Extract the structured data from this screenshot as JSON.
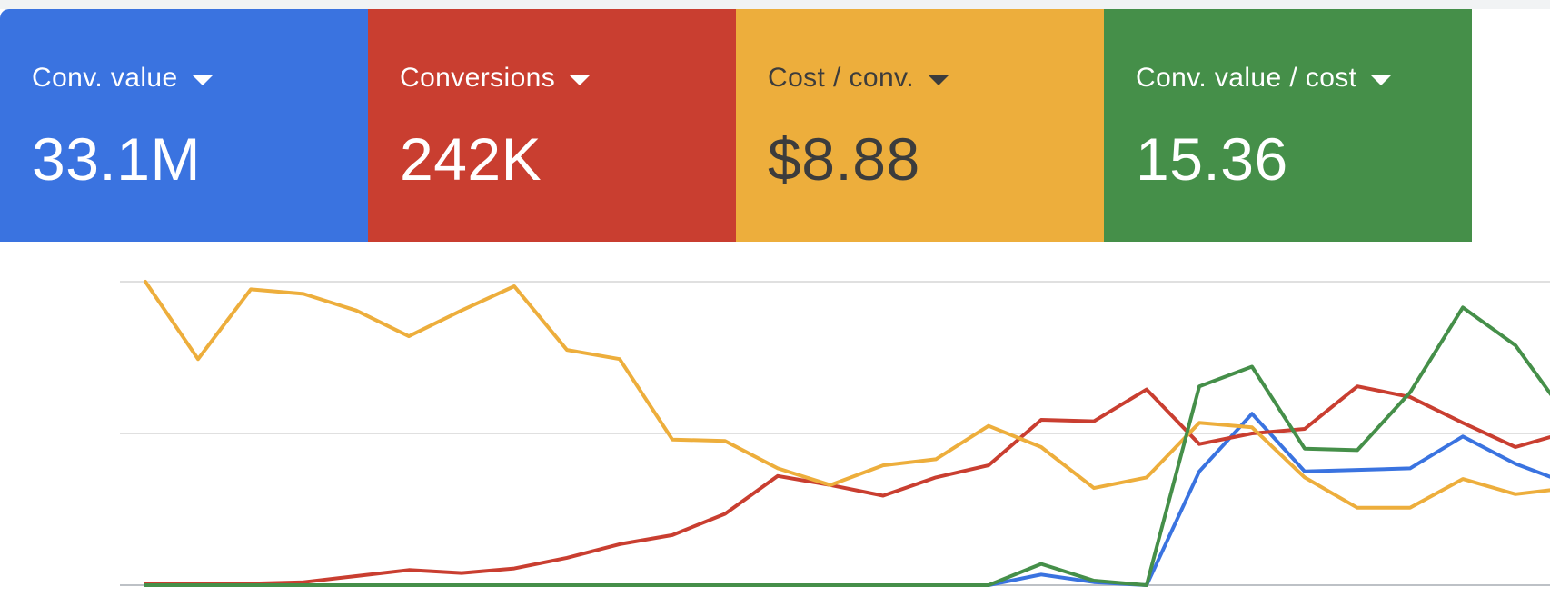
{
  "scorecards": [
    {
      "label": "Conv. value",
      "value": "33.1M",
      "bg": "#3a73e0",
      "fg": "#ffffff",
      "icon": "caret-down-icon"
    },
    {
      "label": "Conversions",
      "value": "242K",
      "bg": "#c93e30",
      "fg": "#ffffff",
      "icon": "caret-down-icon"
    },
    {
      "label": "Cost / conv.",
      "value": "$8.88",
      "bg": "#edae3c",
      "fg": "#3c3c3c",
      "icon": "caret-down-icon"
    },
    {
      "label": "Conv. value / cost",
      "value": "15.36",
      "bg": "#458f49",
      "fg": "#ffffff",
      "icon": "caret-down-icon"
    }
  ],
  "chart_data": {
    "type": "line",
    "x": [
      1,
      2,
      3,
      4,
      5,
      6,
      7,
      8,
      9,
      10,
      11,
      12,
      13,
      14,
      15,
      16,
      17,
      18,
      19,
      20,
      21,
      22,
      23,
      24,
      25,
      26,
      27,
      28,
      29
    ],
    "ylim": [
      0,
      1
    ],
    "grid": true,
    "gridlines": [
      0,
      0.5,
      1
    ],
    "series": [
      {
        "color": "#3a73e0",
        "values": [
          0,
          0,
          0,
          0,
          0,
          0,
          0,
          0,
          0,
          0,
          0,
          0,
          0,
          0,
          0,
          0,
          0,
          0.035,
          0.01,
          0,
          0.375,
          0.565,
          0.375,
          0.38,
          0.385,
          0.49,
          0.4,
          0.335,
          0.28
        ]
      },
      {
        "color": "#c93e30",
        "values": [
          0.005,
          0.005,
          0.005,
          0.01,
          0.03,
          0.05,
          0.04,
          0.055,
          0.09,
          0.135,
          0.165,
          0.235,
          0.36,
          0.33,
          0.295,
          0.355,
          0.395,
          0.545,
          0.54,
          0.645,
          0.465,
          0.5,
          0.515,
          0.655,
          0.62,
          0.535,
          0.455,
          0.505,
          0.465
        ]
      },
      {
        "color": "#edae3c",
        "values": [
          1,
          0.745,
          0.975,
          0.96,
          0.905,
          0.82,
          0.905,
          0.985,
          0.775,
          0.745,
          0.48,
          0.475,
          0.385,
          0.33,
          0.395,
          0.415,
          0.525,
          0.455,
          0.32,
          0.355,
          0.535,
          0.52,
          0.355,
          0.255,
          0.255,
          0.35,
          0.3,
          0.32,
          0.335
        ]
      },
      {
        "color": "#458f49",
        "values": [
          0,
          0,
          0,
          0,
          0,
          0,
          0,
          0,
          0,
          0,
          0,
          0,
          0,
          0,
          0,
          0,
          0,
          0.07,
          0.015,
          0,
          0.655,
          0.72,
          0.45,
          0.445,
          0.635,
          0.915,
          0.79,
          0.55,
          0.66
        ]
      }
    ]
  }
}
